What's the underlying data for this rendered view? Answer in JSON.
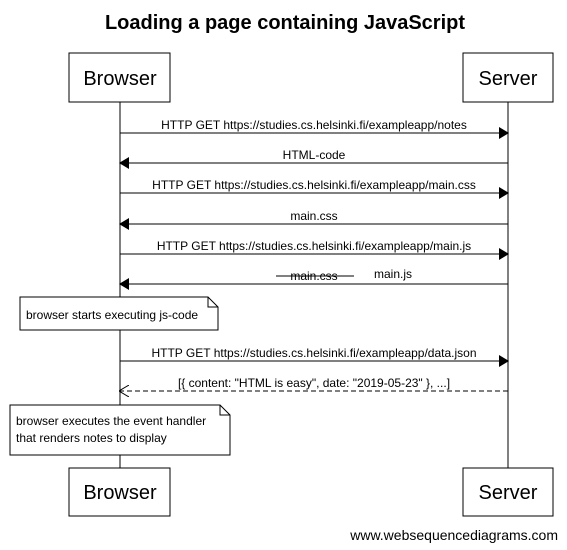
{
  "title": "Loading a page containing JavaScript",
  "participants": {
    "browser": "Browser",
    "server": "Server"
  },
  "messages": [
    {
      "label": "HTTP GET https://studies.cs.helsinki.fi/exampleapp/notes",
      "direction": "request",
      "style": "solid"
    },
    {
      "label": "HTML-code",
      "direction": "response",
      "style": "solid"
    },
    {
      "label": "HTTP GET https://studies.cs.helsinki.fi/exampleapp/main.css",
      "direction": "request",
      "style": "solid"
    },
    {
      "label": "main.css",
      "direction": "response",
      "style": "solid"
    },
    {
      "label": "HTTP GET https://studies.cs.helsinki.fi/exampleapp/main.js",
      "direction": "request",
      "style": "solid"
    },
    {
      "label": "main.css",
      "struck": true,
      "correction": "main.js",
      "direction": "response",
      "style": "solid"
    },
    {
      "label": "HTTP GET https://studies.cs.helsinki.fi/exampleapp/data.json",
      "direction": "request",
      "style": "solid"
    },
    {
      "label": "[{ content: \"HTML is easy\", date: \"2019-05-23\" }, ...]",
      "direction": "response",
      "style": "dashed"
    }
  ],
  "notes": [
    {
      "lines": [
        "browser starts executing js-code"
      ]
    },
    {
      "lines": [
        "browser executes the event handler",
        "that renders notes to display"
      ]
    }
  ],
  "footer": "www.websequencediagrams.com",
  "colors": {
    "line": "#000000",
    "background": "#ffffff",
    "note_fill": "#ffffff"
  }
}
